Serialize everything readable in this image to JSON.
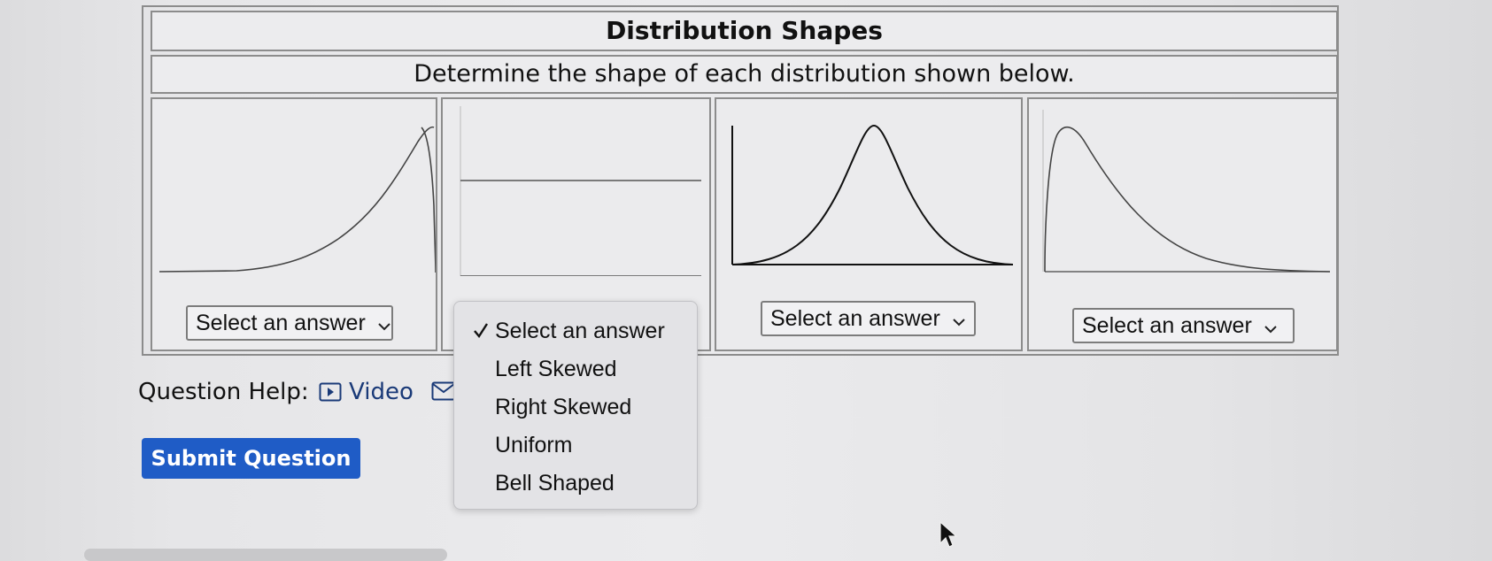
{
  "question": {
    "title": "Distribution Shapes",
    "instruction": "Determine the shape of each distribution shown below."
  },
  "graphs": [
    {
      "icon": "left-skewed-curve-graph",
      "select_value": "Select an answer"
    },
    {
      "icon": "uniform-distribution-graph",
      "select_value": "Select an answer"
    },
    {
      "icon": "bell-curve-graph",
      "select_value": "Select an answer"
    },
    {
      "icon": "right-skewed-curve-graph",
      "select_value": "Select an answer"
    }
  ],
  "dropdown": {
    "selected": "Select an answer",
    "options": [
      "Select an answer",
      "Left Skewed",
      "Right Skewed",
      "Uniform",
      "Bell Shaped"
    ]
  },
  "help": {
    "label": "Question Help:",
    "video_label": "Video",
    "video_icon": "play-icon",
    "message_icon": "mail-icon"
  },
  "submit_label": "Submit Question",
  "colors": {
    "submit_bg": "#1f5cc6",
    "link": "#1a3a78",
    "border": "#8c8c8c"
  }
}
